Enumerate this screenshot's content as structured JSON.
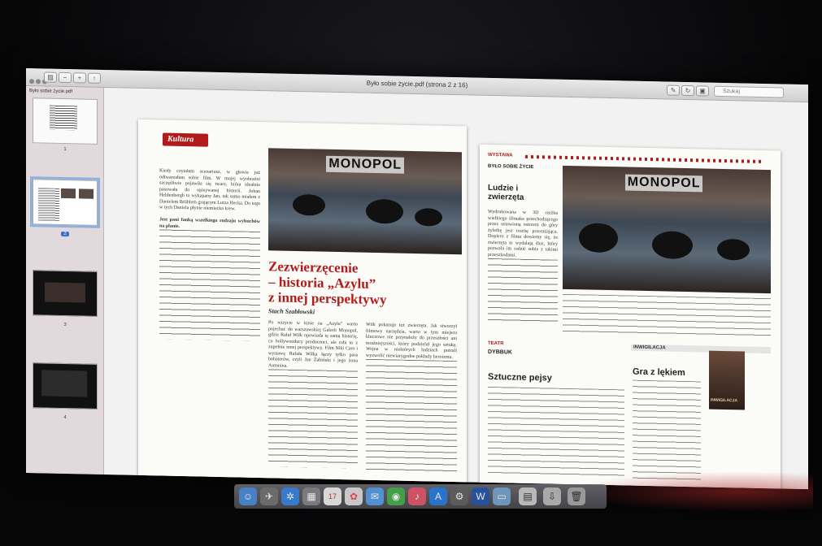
{
  "window": {
    "title": "Było sobie życie.pdf (strona 2 z 16)"
  },
  "toolbar": {
    "search_placeholder": "Szukaj"
  },
  "sidebar": {
    "document_name": "Było sobie życie.pdf",
    "pages": [
      "1",
      "2",
      "3",
      "4"
    ],
    "selected_page": "2"
  },
  "left_page": {
    "section": "Kultura",
    "headline_line1": "Zezwierzęcenie",
    "headline_line2": "– historia „Azylu”",
    "headline_line3": "z innej perspektywy",
    "author": "Stach Szabłowski",
    "photo_sign": "MONOPOL",
    "col1_text": "Kiedy czytałam scenariusz, w głowie już odtwarzałam sobie film. W mojej wyobraźni szczęśliwie pojawiła się twarz, która idealnie pasowała do opisywanej historii. Johan Heldenbergh to wykapany Jan, tak samo miałam z Danielem Brühlem grającym Lutza Hecka. Do tego w tych Daniela płynie niemiecka krew.",
    "col1_question": "Jest pani fanką wszelkiego rodzaju wybuchów na planie.",
    "col2_text": "Po wizycie w kinie na „Azylu” warto pojechać do warszawskiej Galerii Monopol, gdzie Rafał Wilk opowiada tę samą historię, co hollywoodzcy producenci, ale robi to z zupełnie innej perspektywy. Film Niki Caro i wystawę Rafała Wilka łączy tylko para bohaterów, czyli Jan Żabiński i jego żona Antonina.",
    "col3_text": "Wilk pokazuje też zwierzęta. Jak stworzył filmowy narzędzia, warto w tym miejscu kluczowe nie przynależy do przeszłości ani teraźniejszości, który podzielał jego sztukę. Wojna w niektórych ludziach potrafi wyzwolić niewiarygodne pokłady heroizmu."
  },
  "right_page": {
    "top_bar": "WYSTAWA",
    "kicker": "BYŁO SOBIE ŻYCIE",
    "headline": "Ludzie i zwierzęta",
    "photo_sign": "MONOPOL",
    "body_text": "Wydrukowana w 3D rzeźba wielkiego ślimaka przechodzącego przez ustawioną ostrzem do góry żyletkę jest trochę przerażająca. Dopiero z filmu dowiemy się, że zwierzęta te wydalają śluz, który pozwala im radzić sobie z takimi przeszkodami.",
    "section2": "TEATR",
    "section2_kicker": "DYBBUK",
    "section2_headline": "Sztuczne pejsy",
    "section3": "INWIGILACJA",
    "section3_headline": "Gra z lękiem",
    "book_title": "INWIGILACJA"
  },
  "colors": {
    "accent": "#b01c1c",
    "selection": "#3b6fd1"
  }
}
